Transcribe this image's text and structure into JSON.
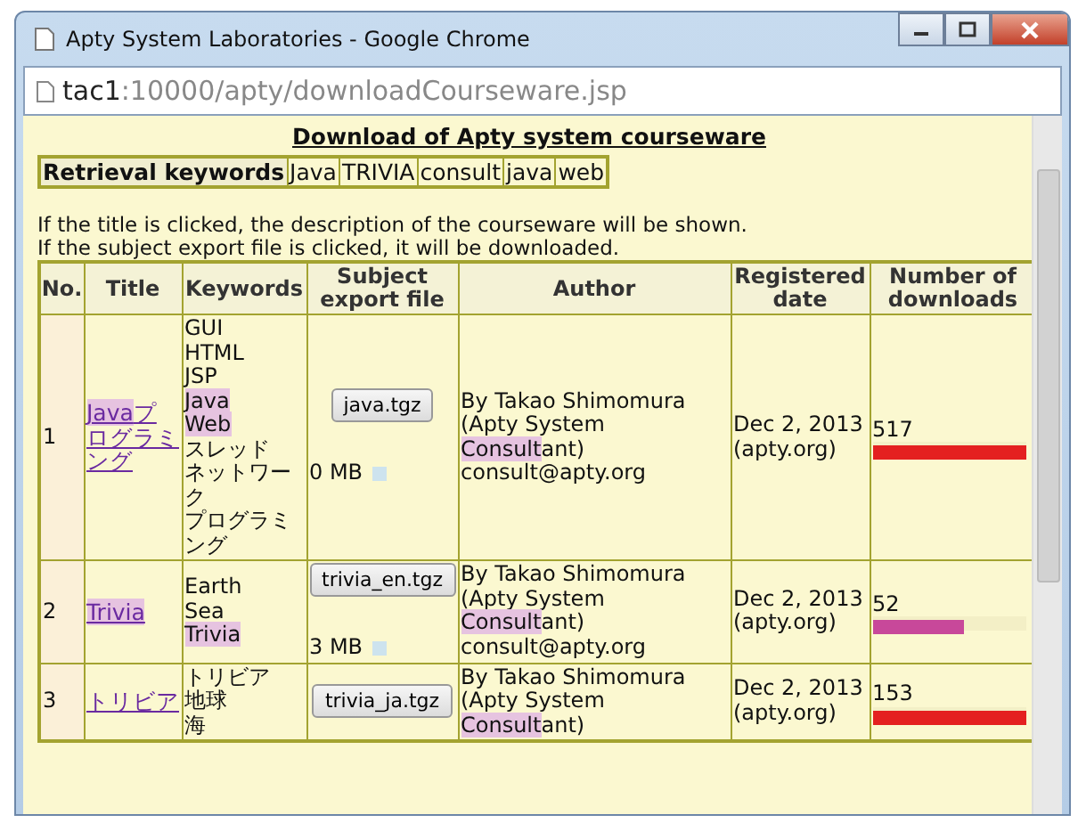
{
  "window": {
    "title": "Apty System Laboratories - Google Chrome"
  },
  "address": {
    "host": "tac1",
    "path": ":10000/apty/downloadCourseware.jsp"
  },
  "page": {
    "heading": "Download of Apty system courseware",
    "keywords_label": "Retrieval keywords",
    "keywords": [
      "Java",
      "TRIVIA",
      "consult",
      "java",
      "web"
    ],
    "notes": [
      "If the title is clicked, the description of the courseware will be shown.",
      "If the subject export file is clicked, it will be downloaded."
    ],
    "table": {
      "columns": [
        "No.",
        "Title",
        "Keywords",
        "Subject export file",
        "Author",
        "Registered date",
        "Number of downloads"
      ],
      "rows": [
        {
          "no": "1",
          "title": [
            {
              "text": "Java",
              "highlighted": true
            },
            {
              "text": "プログラミング",
              "highlighted": false
            }
          ],
          "keywords": [
            {
              "text": "GUI",
              "highlighted": false
            },
            {
              "text": "HTML",
              "highlighted": false
            },
            {
              "text": "JSP",
              "highlighted": false
            },
            {
              "text": "Java",
              "highlighted": true
            },
            {
              "text": "Web",
              "highlighted": true
            },
            {
              "text": "スレッド",
              "highlighted": false
            },
            {
              "text": "ネットワーク",
              "highlighted": false
            },
            {
              "text": "プログラミング",
              "highlighted": false
            }
          ],
          "file": "java.tgz",
          "size": "0 MB",
          "author": [
            [
              {
                "text": "By Takao Shimomura",
                "highlighted": false
              }
            ],
            [
              {
                "text": "(Apty System",
                "highlighted": false
              }
            ],
            [
              {
                "text": "Consult",
                "highlighted": true
              },
              {
                "text": "ant)",
                "highlighted": false
              }
            ],
            [
              {
                "text": "consult@apty.org",
                "highlighted": false
              }
            ]
          ],
          "date": "Dec 2, 2013",
          "source": "(apty.org)",
          "downloads": "517",
          "level": 1,
          "color": "#e42020"
        },
        {
          "no": "2",
          "title": [
            {
              "text": "Trivia",
              "highlighted": true
            }
          ],
          "keywords": [
            {
              "text": "Earth",
              "highlighted": false
            },
            {
              "text": "Sea",
              "highlighted": false
            },
            {
              "text": "Trivia",
              "highlighted": true
            }
          ],
          "file": "trivia_en.tgz",
          "size": "3 MB",
          "author": [
            [
              {
                "text": "By Takao Shimomura",
                "highlighted": false
              }
            ],
            [
              {
                "text": "(Apty System",
                "highlighted": false
              }
            ],
            [
              {
                "text": "Consult",
                "highlighted": true
              },
              {
                "text": "ant)",
                "highlighted": false
              }
            ],
            [
              {
                "text": "consult@apty.org",
                "highlighted": false
              }
            ]
          ],
          "date": "Dec 2, 2013",
          "source": "(apty.org)",
          "downloads": "52",
          "level": 0.6,
          "color": "#c8489a"
        },
        {
          "no": "3",
          "title": [
            {
              "text": "トリビア",
              "highlighted": false
            }
          ],
          "keywords": [
            {
              "text": "トリビア",
              "highlighted": false
            },
            {
              "text": "地球",
              "highlighted": false
            },
            {
              "text": "海",
              "highlighted": false
            }
          ],
          "file": "trivia_ja.tgz",
          "author": [
            [
              {
                "text": "By Takao Shimomura",
                "highlighted": false
              }
            ],
            [
              {
                "text": "(Apty System",
                "highlighted": false
              }
            ],
            [
              {
                "text": "Consult",
                "highlighted": true
              },
              {
                "text": "ant)",
                "highlighted": false
              }
            ]
          ],
          "date": "Dec 2, 2013",
          "source": "(apty.org)",
          "downloads": "153",
          "level": 1,
          "color": "#e42020"
        }
      ]
    }
  }
}
